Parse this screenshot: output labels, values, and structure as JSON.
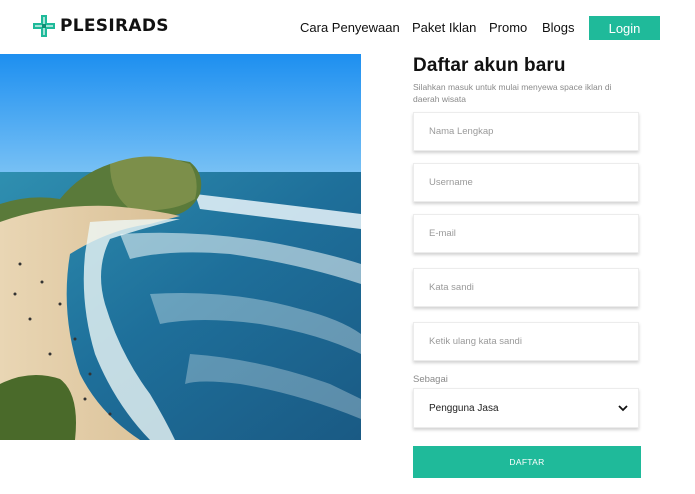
{
  "brand": {
    "name": "PLESIRADS",
    "accent": "#1fba9a"
  },
  "nav": {
    "items": [
      "Cara Penyewaan",
      "Paket Iklan",
      "Promo",
      "Blogs"
    ],
    "login_label": "Login"
  },
  "hero_image": {
    "alt": "beach-photo"
  },
  "form": {
    "title": "Daftar akun baru",
    "subtitle": "Silahkan masuk untuk mulai menyewa space iklan di daerah wisata",
    "fields": [
      {
        "placeholder": "Nama Lengkap"
      },
      {
        "placeholder": "Username"
      },
      {
        "placeholder": "E-mail"
      },
      {
        "placeholder": "Kata sandi"
      },
      {
        "placeholder": "Ketik ulang kata sandi"
      }
    ],
    "role_label": "Sebagai",
    "role_selected": "Pengguna Jasa",
    "submit_label": "DAFTAR"
  }
}
